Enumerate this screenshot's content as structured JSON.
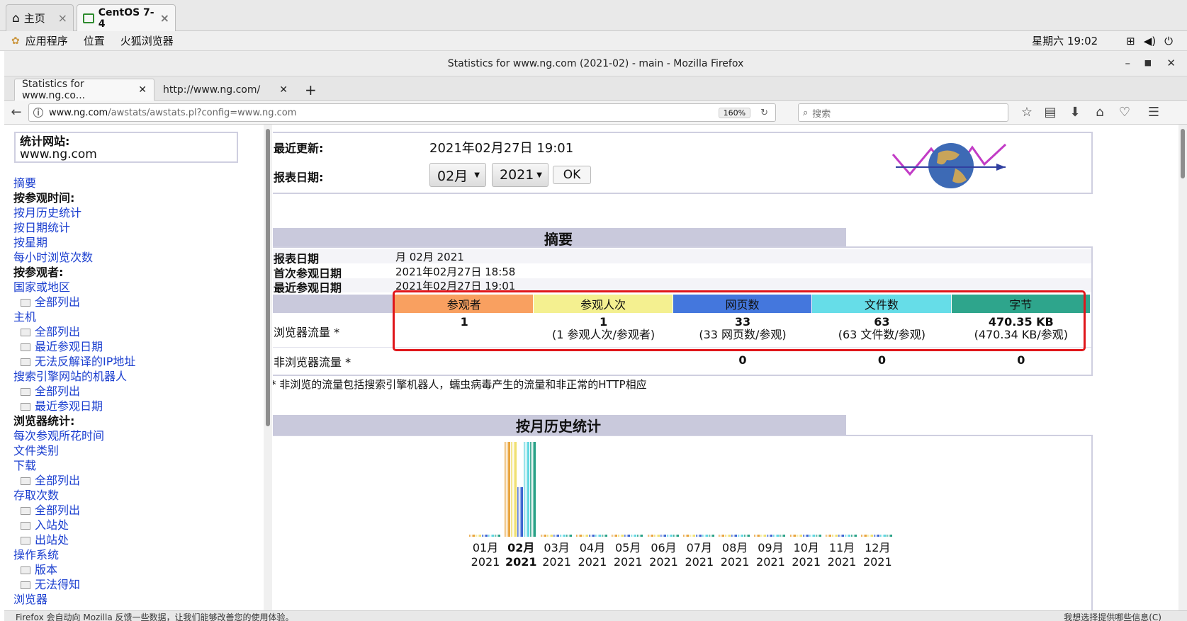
{
  "vm_tabs": [
    {
      "label": "主页"
    },
    {
      "label": "CentOS 7-4"
    }
  ],
  "gnome": {
    "apps": "应用程序",
    "places": "位置",
    "browser": "火狐浏览器",
    "clock": "星期六 19:02"
  },
  "window": {
    "title": "Statistics for www.ng.com (2021-02) - main - Mozilla Firefox"
  },
  "tabs": [
    {
      "label": "Statistics for www.ng.co..."
    },
    {
      "label": "http://www.ng.com/"
    }
  ],
  "nav": {
    "url_host": "www.ng.com",
    "url_path": "/awstats/awstats.pl?config=www.ng.com",
    "zoom": "160%",
    "search_placeholder": "搜索"
  },
  "left": {
    "site_label": "统计网站:",
    "site_value": "www.ng.com",
    "menu": [
      {
        "t": "摘要",
        "k": "link"
      },
      {
        "t": "按参观时间:",
        "k": "head"
      },
      {
        "t": "按月历史统计",
        "k": "link"
      },
      {
        "t": "按日期统计",
        "k": "link"
      },
      {
        "t": "按星期",
        "k": "link"
      },
      {
        "t": "每小时浏览次数",
        "k": "link"
      },
      {
        "t": "按参观者:",
        "k": "head"
      },
      {
        "t": "国家或地区",
        "k": "link"
      },
      {
        "t": "全部列出",
        "k": "sub"
      },
      {
        "t": "主机",
        "k": "link"
      },
      {
        "t": "全部列出",
        "k": "sub"
      },
      {
        "t": "最近参观日期",
        "k": "sub"
      },
      {
        "t": "无法反解译的IP地址",
        "k": "sub"
      },
      {
        "t": "搜索引擎网站的机器人",
        "k": "link"
      },
      {
        "t": "全部列出",
        "k": "sub"
      },
      {
        "t": "最近参观日期",
        "k": "sub"
      },
      {
        "t": "浏览器统计:",
        "k": "head"
      },
      {
        "t": "每次参观所花时间",
        "k": "link"
      },
      {
        "t": "文件类别",
        "k": "link"
      },
      {
        "t": "下载",
        "k": "link"
      },
      {
        "t": "全部列出",
        "k": "sub"
      },
      {
        "t": "存取次数",
        "k": "link"
      },
      {
        "t": "全部列出",
        "k": "sub"
      },
      {
        "t": "入站处",
        "k": "sub"
      },
      {
        "t": "出站处",
        "k": "sub"
      },
      {
        "t": "操作系统",
        "k": "link"
      },
      {
        "t": "版本",
        "k": "sub"
      },
      {
        "t": "无法得知",
        "k": "sub"
      },
      {
        "t": "浏览器",
        "k": "link"
      }
    ]
  },
  "top": {
    "last_update_label": "最近更新:",
    "last_update_value": "2021年02月27日 19:01",
    "report_label": "报表日期:",
    "month": "02月",
    "year": "2021",
    "ok": "OK"
  },
  "summary": {
    "title": "摘要",
    "rows": [
      {
        "label": "报表日期",
        "value": "月 02月 2021"
      },
      {
        "label": "首次参观日期",
        "value": "2021年02月27日 18:58"
      },
      {
        "label": "最近参观日期",
        "value": "2021年02月27日 19:01"
      }
    ],
    "columns": [
      {
        "name": "参观者",
        "color": "#f9a060"
      },
      {
        "name": "参观人次",
        "color": "#f4f090"
      },
      {
        "name": "网页数",
        "color": "#4477dd"
      },
      {
        "name": "文件数",
        "color": "#66dde8"
      },
      {
        "name": "字节",
        "color": "#2ea58c"
      }
    ],
    "browser_label": "浏览器流量 *",
    "browser": [
      {
        "main": "1",
        "sub": ""
      },
      {
        "main": "1",
        "sub": "(1 参观人次/参观者)"
      },
      {
        "main": "33",
        "sub": "(33 网页数/参观)"
      },
      {
        "main": "63",
        "sub": "(63 文件数/参观)"
      },
      {
        "main": "470.35 KB",
        "sub": "(470.34 KB/参观)"
      }
    ],
    "nonbrowser_label": "非浏览器流量 *",
    "nonbrowser": [
      "",
      "",
      "0",
      "0",
      "0"
    ],
    "footnote": "* 非浏览的流量包括搜索引擎机器人，蠕虫病毒产生的流量和非正常的HTTP相应"
  },
  "history": {
    "title": "按月历史统计"
  },
  "chart_data": {
    "type": "bar",
    "categories": [
      "01月",
      "02月",
      "03月",
      "04月",
      "05月",
      "06月",
      "07月",
      "08月",
      "09月",
      "10月",
      "11月",
      "12月"
    ],
    "year_labels": [
      "2021",
      "2021",
      "2021",
      "2021",
      "2021",
      "2021",
      "2021",
      "2021",
      "2021",
      "2021",
      "2021",
      "2021"
    ],
    "highlight": "02月",
    "series": [
      {
        "name": "参观者",
        "color": "#e8a33c",
        "values": [
          0,
          1,
          0,
          0,
          0,
          0,
          0,
          0,
          0,
          0,
          0,
          0
        ]
      },
      {
        "name": "参观人次",
        "color": "#f0e070",
        "values": [
          0,
          1,
          0,
          0,
          0,
          0,
          0,
          0,
          0,
          0,
          0,
          0
        ]
      },
      {
        "name": "网页数",
        "color": "#3b64d0",
        "values": [
          0,
          33,
          0,
          0,
          0,
          0,
          0,
          0,
          0,
          0,
          0,
          0
        ]
      },
      {
        "name": "文件数",
        "color": "#5fd6e0",
        "values": [
          0,
          63,
          0,
          0,
          0,
          0,
          0,
          0,
          0,
          0,
          0,
          0
        ]
      },
      {
        "name": "字节",
        "color": "#26a085",
        "values": [
          0,
          470.35,
          0,
          0,
          0,
          0,
          0,
          0,
          0,
          0,
          0,
          0
        ]
      }
    ]
  },
  "status": {
    "left": "Firefox 会自动向 Mozilla 反馈一些数据，让我们能够改善您的使用体验。",
    "right": "我想选择提供哪些信息(C)"
  }
}
